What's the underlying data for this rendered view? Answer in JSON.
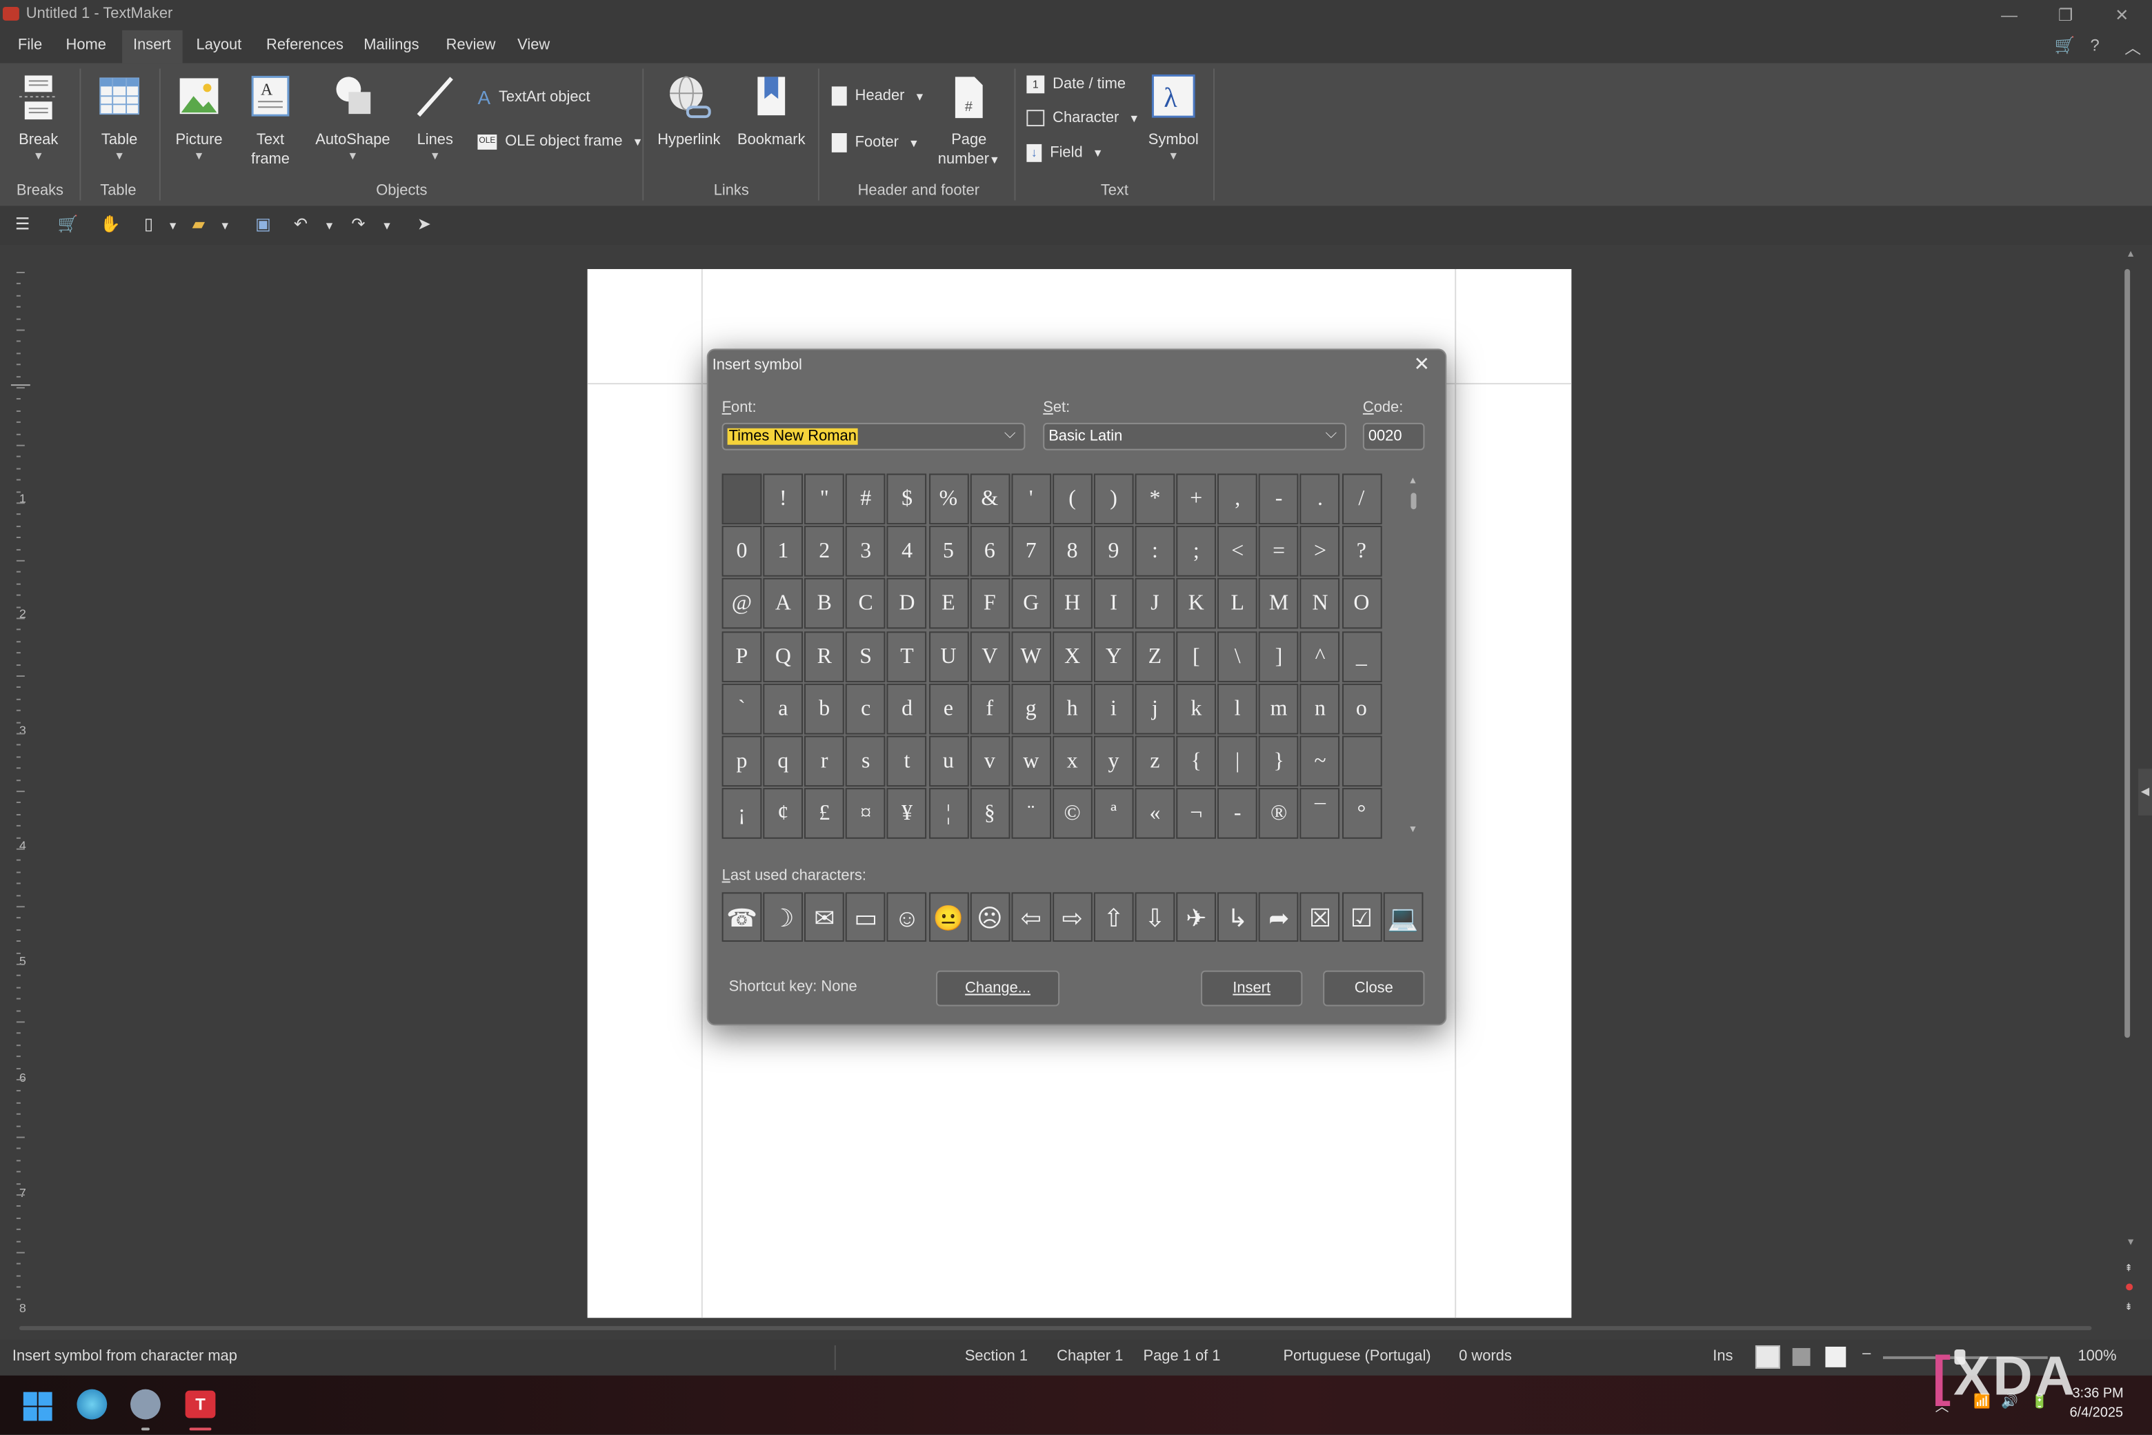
{
  "window": {
    "title": "Untitled 1 - TextMaker"
  },
  "menu": {
    "items": [
      "File",
      "Home",
      "Insert",
      "Layout",
      "References",
      "Mailings",
      "Review",
      "View"
    ],
    "active": "Insert"
  },
  "ribbon": {
    "break": "Break",
    "table": "Table",
    "picture": "Picture",
    "text_frame_1": "Text",
    "text_frame_2": "frame",
    "autoshape": "AutoShape",
    "lines": "Lines",
    "textart": "TextArt object",
    "ole": "OLE object frame",
    "hyperlink": "Hyperlink",
    "bookmark": "Bookmark",
    "header": "Header",
    "footer": "Footer",
    "page_number_1": "Page",
    "page_number_2": "number",
    "date_time": "Date / time",
    "character": "Character",
    "field": "Field",
    "symbol": "Symbol",
    "groups": {
      "breaks": "Breaks",
      "table": "Table",
      "objects": "Objects",
      "links": "Links",
      "header_footer": "Header and footer",
      "text": "Text"
    }
  },
  "dialog": {
    "title": "Insert symbol",
    "font_label_u": "F",
    "font_label_rest": "ont:",
    "font_value": "Times New Roman",
    "set_label_u": "S",
    "set_label_rest": "et:",
    "set_value": "Basic Latin",
    "code_label_u": "C",
    "code_label_rest": "ode:",
    "code_value": "0020",
    "grid": [
      [
        " ",
        "!",
        "\"",
        "#",
        "$",
        "%",
        "&",
        "'",
        "(",
        ")",
        "*",
        "+",
        ",",
        "-",
        ".",
        "/"
      ],
      [
        "0",
        "1",
        "2",
        "3",
        "4",
        "5",
        "6",
        "7",
        "8",
        "9",
        ":",
        ";",
        "<",
        "=",
        ">",
        "?"
      ],
      [
        "@",
        "A",
        "B",
        "C",
        "D",
        "E",
        "F",
        "G",
        "H",
        "I",
        "J",
        "K",
        "L",
        "M",
        "N",
        "O"
      ],
      [
        "P",
        "Q",
        "R",
        "S",
        "T",
        "U",
        "V",
        "W",
        "X",
        "Y",
        "Z",
        "[",
        "\\",
        "]",
        "^",
        "_"
      ],
      [
        "`",
        "a",
        "b",
        "c",
        "d",
        "e",
        "f",
        "g",
        "h",
        "i",
        "j",
        "k",
        "l",
        "m",
        "n",
        "o"
      ],
      [
        "p",
        "q",
        "r",
        "s",
        "t",
        "u",
        "v",
        "w",
        "x",
        "y",
        "z",
        "{",
        "|",
        "}",
        "~",
        ""
      ],
      [
        "¡",
        "¢",
        "£",
        "¤",
        "¥",
        "¦",
        "§",
        "¨",
        "©",
        "ª",
        "«",
        "¬",
        "-",
        "®",
        "¯",
        "°"
      ]
    ],
    "last_used_label_u": "L",
    "last_used_label_rest": "ast used characters:",
    "last_used": [
      "☎",
      "☽",
      "✉",
      "▭",
      "☺",
      "😐",
      "☹",
      "⇦",
      "⇨",
      "⇧",
      "⇩",
      "✈",
      "↳",
      "➦",
      "☒",
      "☑",
      "💻"
    ],
    "shortcut": "Shortcut key: None",
    "change_button": "Change...",
    "insert_button": "Insert",
    "close_button": "Close"
  },
  "statusbar": {
    "hint": "Insert symbol from character map",
    "section": "Section 1",
    "chapter": "Chapter 1",
    "page": "Page 1 of 1",
    "language": "Portuguese (Portugal)",
    "words": "0 words",
    "mode": "Ins",
    "zoom": "100%"
  },
  "taskbar": {
    "time": "3:36 PM",
    "date": "6/4/2025"
  },
  "watermark": "XDA",
  "ruler_numbers": [
    "1",
    "2",
    "3",
    "4",
    "5",
    "6",
    "7",
    "8"
  ]
}
